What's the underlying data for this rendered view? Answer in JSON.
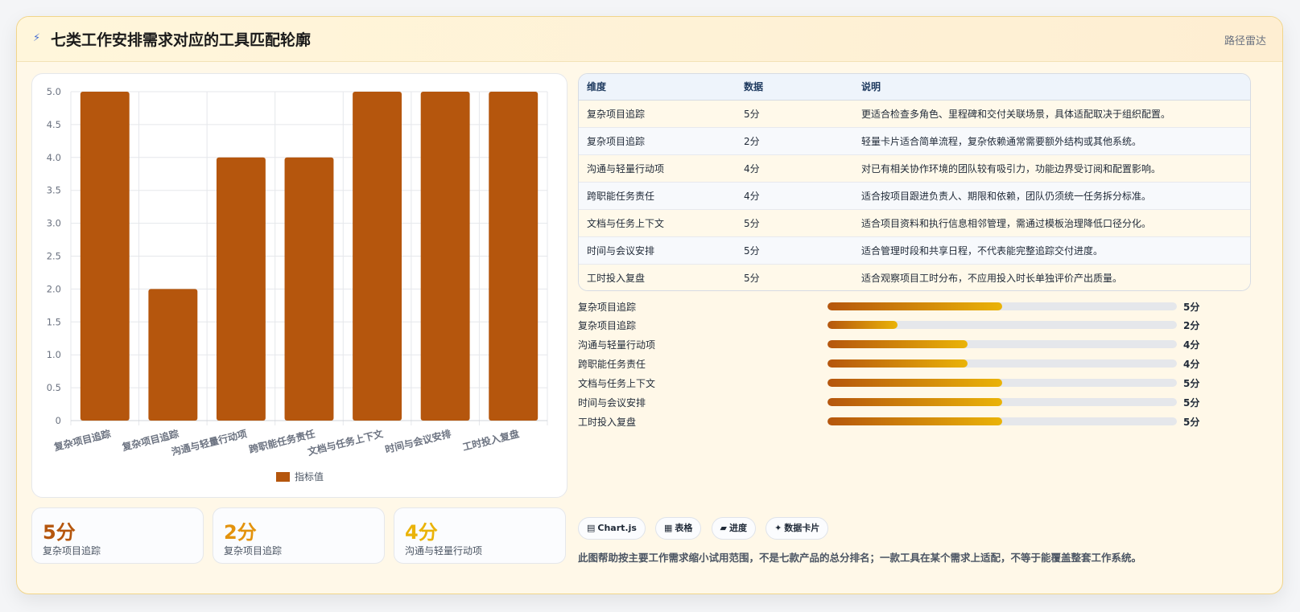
{
  "header": {
    "title": "七类工作安排需求对应的工具匹配轮廓",
    "tag": "路径雷达"
  },
  "chart_data": {
    "type": "bar",
    "categories": [
      "复杂项目追踪",
      "复杂项目追踪",
      "沟通与轻量行动项",
      "跨职能任务责任",
      "文档与任务上下文",
      "时间与会议安排",
      "工时投入复盘"
    ],
    "series": [
      {
        "name": "指标值",
        "values": [
          5,
          2,
          4,
          4,
          5,
          5,
          5
        ]
      }
    ],
    "ylim": [
      0,
      5
    ],
    "yticks": [
      "0",
      "0.5",
      "1.0",
      "1.5",
      "2.0",
      "2.5",
      "3.0",
      "3.5",
      "4.0",
      "4.5",
      "5.0"
    ],
    "color": "#b5560d",
    "grid": true,
    "legend": "bottom"
  },
  "kpis": [
    {
      "value": "5分",
      "label": "复杂项目追踪",
      "color": "#b5560d"
    },
    {
      "value": "2分",
      "label": "复杂项目追踪",
      "color": "#e3930d"
    },
    {
      "value": "4分",
      "label": "沟通与轻量行动项",
      "color": "#eab308"
    }
  ],
  "table": {
    "headers": [
      "维度",
      "数据",
      "说明"
    ],
    "rows": [
      [
        "复杂项目追踪",
        "5分",
        "更适合检查多角色、里程碑和交付关联场景，具体适配取决于组织配置。"
      ],
      [
        "复杂项目追踪",
        "2分",
        "轻量卡片适合简单流程，复杂依赖通常需要额外结构或其他系统。"
      ],
      [
        "沟通与轻量行动项",
        "4分",
        "对已有相关协作环境的团队较有吸引力，功能边界受订阅和配置影响。"
      ],
      [
        "跨职能任务责任",
        "4分",
        "适合按项目跟进负责人、期限和依赖，团队仍须统一任务拆分标准。"
      ],
      [
        "文档与任务上下文",
        "5分",
        "适合项目资料和执行信息相邻管理，需通过模板治理降低口径分化。"
      ],
      [
        "时间与会议安排",
        "5分",
        "适合管理时段和共享日程，不代表能完整追踪交付进度。"
      ],
      [
        "工时投入复盘",
        "5分",
        "适合观察项目工时分布，不应用投入时长单独评价产出质量。"
      ]
    ]
  },
  "progress": [
    {
      "label": "复杂项目追踪",
      "value": 5,
      "max": 10,
      "score": "5分"
    },
    {
      "label": "复杂项目追踪",
      "value": 2,
      "max": 10,
      "score": "2分"
    },
    {
      "label": "沟通与轻量行动项",
      "value": 4,
      "max": 10,
      "score": "4分"
    },
    {
      "label": "跨职能任务责任",
      "value": 4,
      "max": 10,
      "score": "4分"
    },
    {
      "label": "文档与任务上下文",
      "value": 5,
      "max": 10,
      "score": "5分"
    },
    {
      "label": "时间与会议安排",
      "value": 5,
      "max": 10,
      "score": "5分"
    },
    {
      "label": "工时投入复盘",
      "value": 5,
      "max": 10,
      "score": "5分"
    }
  ],
  "chips": [
    {
      "icon": "chart-icon",
      "glyph": "▤",
      "label": "Chart.js"
    },
    {
      "icon": "table-icon",
      "glyph": "▦",
      "label": "表格"
    },
    {
      "icon": "progress-icon",
      "glyph": "▰",
      "label": "进度"
    },
    {
      "icon": "sparkle-icon",
      "glyph": "✦",
      "label": "数据卡片"
    }
  ],
  "note": "此图帮助按主要工作需求缩小试用范围，不是七款产品的总分排名；一款工具在某个需求上适配，不等于能覆盖整套工作系统。"
}
